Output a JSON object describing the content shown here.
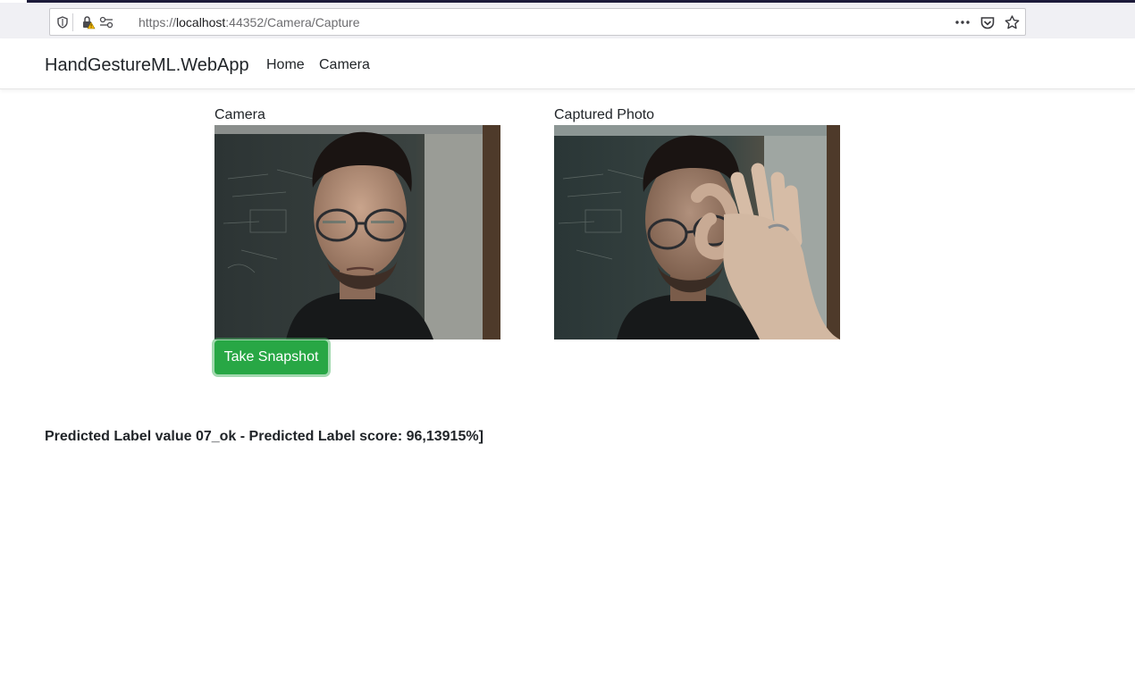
{
  "browser": {
    "url_prefix": "https://",
    "url_host": "localhost",
    "url_path": ":44352/Camera/Capture",
    "icons": [
      "shield-icon",
      "lock-warning-icon",
      "permissions-icon",
      "more-icon",
      "pocket-icon",
      "star-icon"
    ]
  },
  "navbar": {
    "brand": "HandGestureML.WebApp",
    "links": [
      "Home",
      "Camera"
    ]
  },
  "camera": {
    "label": "Camera",
    "button_label": "Take Snapshot"
  },
  "captured": {
    "label": "Captured Photo"
  },
  "prediction": {
    "text": "Predicted Label value 07_ok - Predicted Label score: 96,13915%]"
  },
  "colors": {
    "accent_button": "#28a745",
    "text": "#212529",
    "chrome_bg": "#f0f0f4"
  }
}
